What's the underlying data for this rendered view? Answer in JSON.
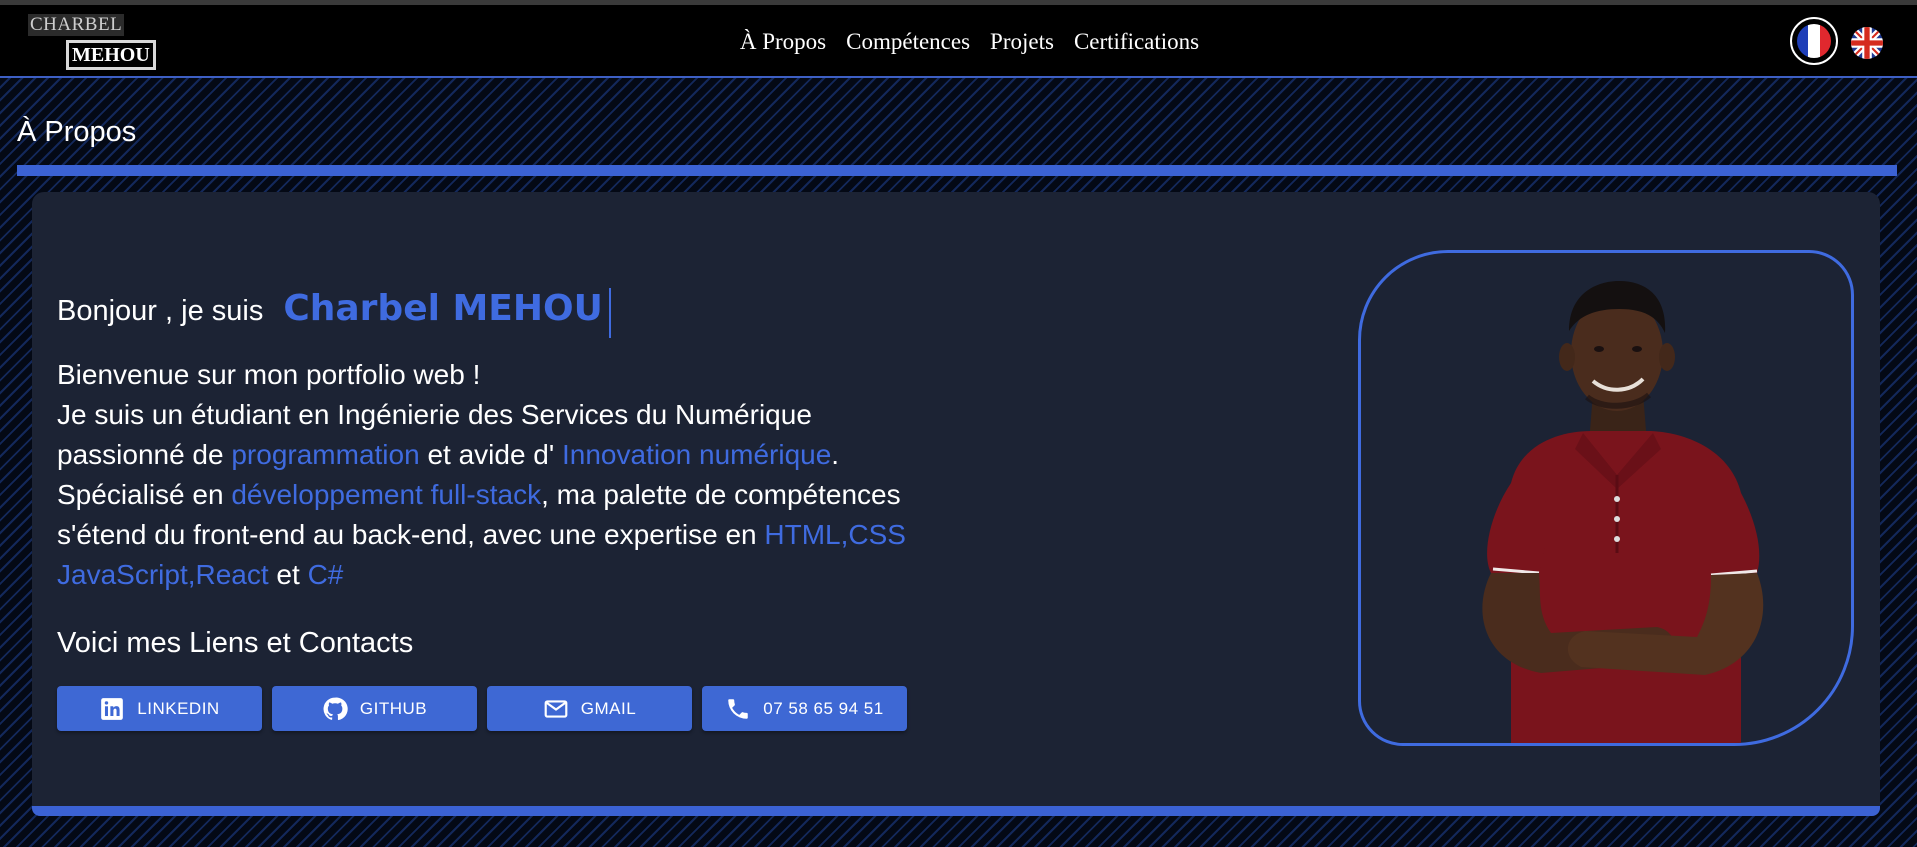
{
  "header": {
    "logo_top": "CHARBEL",
    "logo_bottom": "MEHOU",
    "nav": [
      "À Propos",
      "Compétences",
      "Projets",
      "Certifications"
    ],
    "languages": {
      "fr_icon": "flag-france-icon",
      "en_icon": "flag-uk-icon"
    }
  },
  "section": {
    "title": "À Propos"
  },
  "hero": {
    "intro": "Bonjour , je suis",
    "name": "Charbel MEHOU",
    "bio": {
      "line1": "Bienvenue sur mon portfolio web !",
      "line2": "Je suis un étudiant en Ingénierie des Services du Numérique",
      "line3_a": "passionné de ",
      "line3_hl1": "programmation",
      "line3_b": " et avide d' ",
      "line3_hl2": "Innovation numérique",
      "line3_c": ".",
      "line4_a": "Spécialisé en ",
      "line4_hl": "développement full-stack",
      "line4_b": ", ma palette de compétences",
      "line5_a": "s'étend du front-end au back-end, avec une expertise en ",
      "line5_hl": "HTML,CSS",
      "line6_hl1": "JavaScript,React",
      "line6_b": " et ",
      "line6_hl2": "C#"
    },
    "links_title": "Voici mes Liens et Contacts",
    "buttons": [
      {
        "label": "LINKEDIN",
        "icon": "linkedin-icon"
      },
      {
        "label": "GITHUB",
        "icon": "github-icon"
      },
      {
        "label": "GMAIL",
        "icon": "mail-icon"
      },
      {
        "label": "07 58 65 94 51",
        "icon": "phone-icon"
      }
    ]
  },
  "colors": {
    "accent": "#3f6be0",
    "card": "#1c2334",
    "header": "#000000",
    "button": "#3e68d4"
  }
}
